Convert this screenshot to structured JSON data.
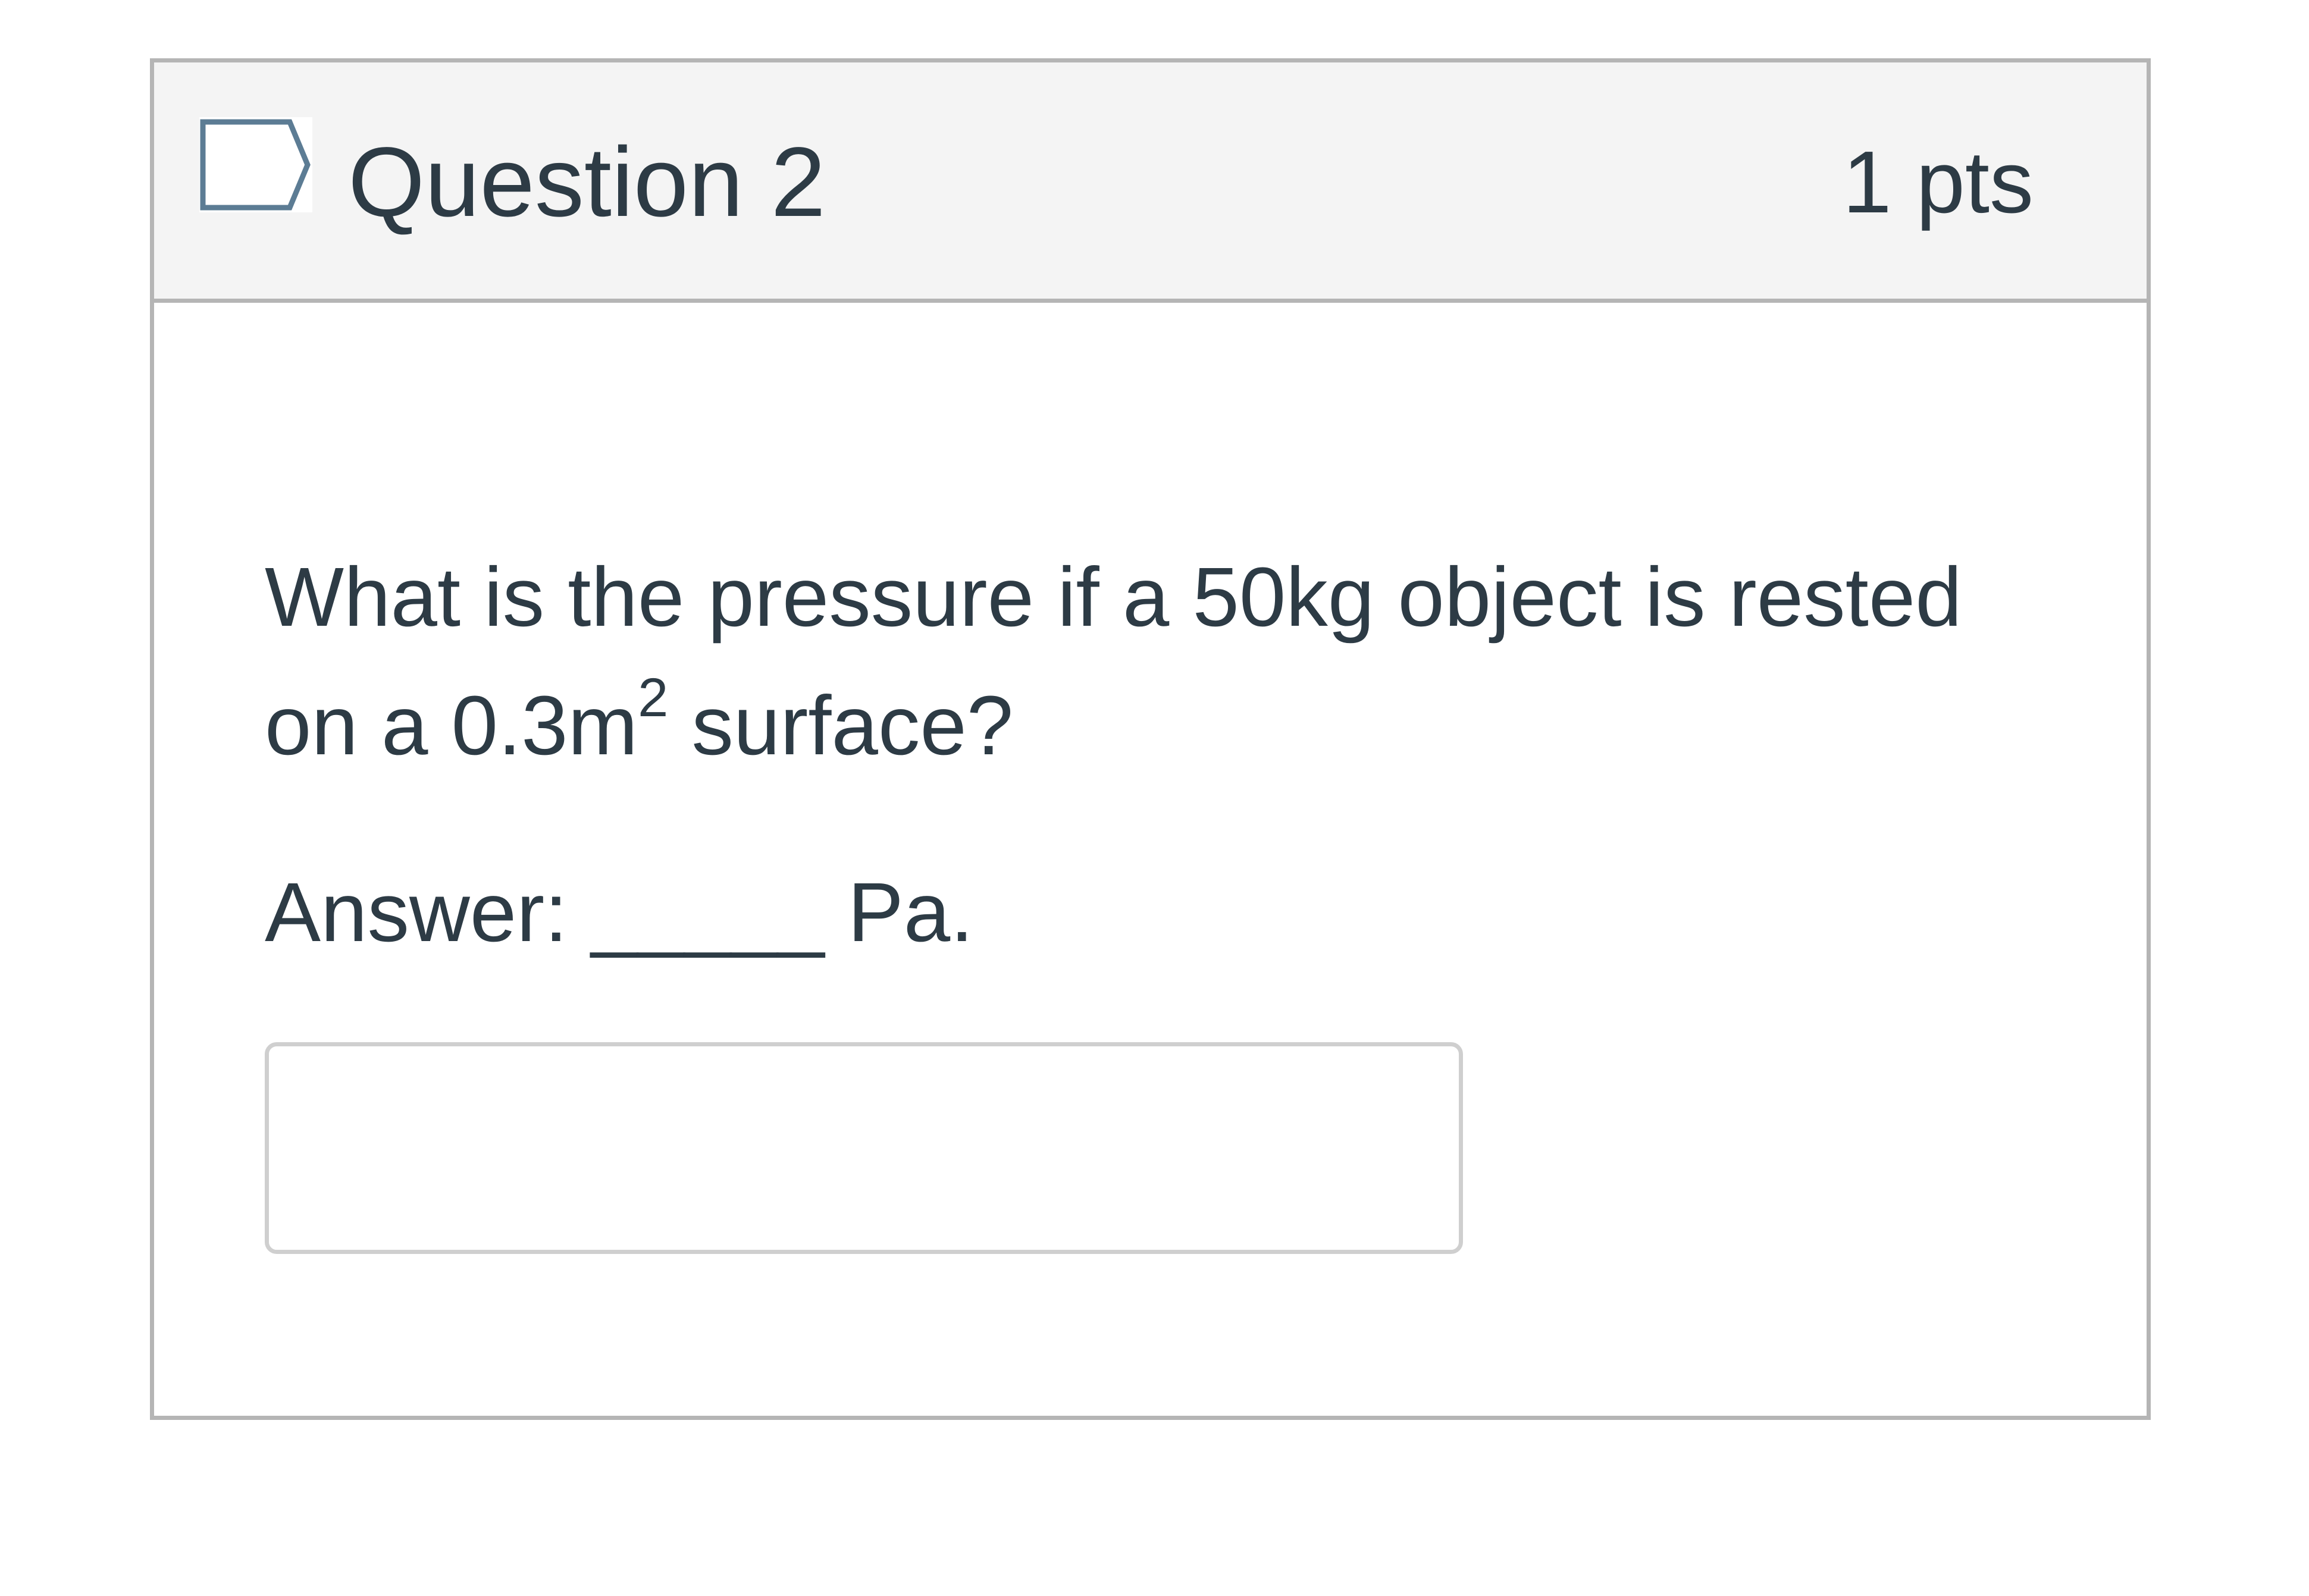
{
  "question": {
    "title": "Question 2",
    "points": "1 pts",
    "flag_icon": "flag-icon",
    "text_part1": "What is the pressure if a 50kg object is rested on a 0.3m",
    "text_sup": "2",
    "text_part2": " surface?",
    "answer_prompt": "Answer: _____ Pa.",
    "answer_value": "",
    "answer_placeholder": ""
  },
  "colors": {
    "header_bg": "#f4f4f4",
    "border": "#b5b5b5",
    "text": "#2d3b45",
    "flag_stroke": "#5c7c94"
  }
}
